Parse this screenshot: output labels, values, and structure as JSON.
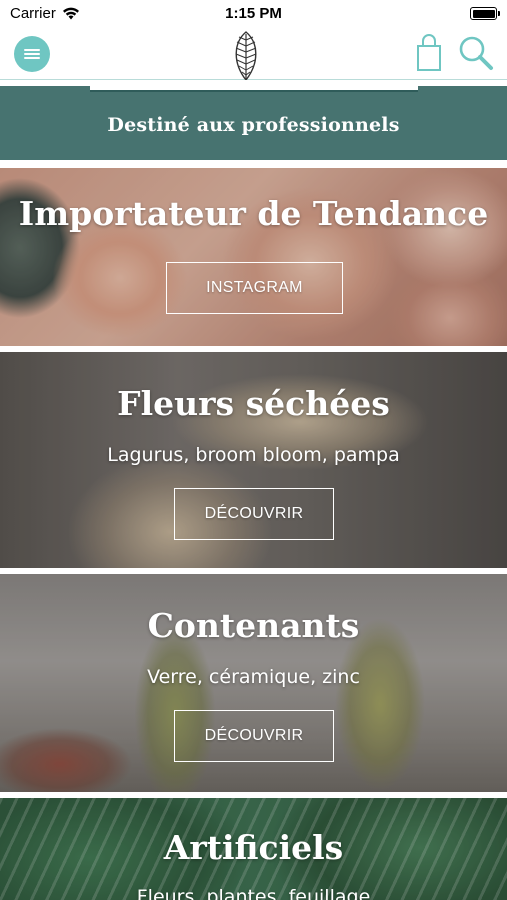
{
  "status_bar": {
    "carrier": "Carrier",
    "time": "1:15 PM"
  },
  "nav": {
    "menu_icon": "hamburger-menu-icon",
    "logo_icon": "leaf-logo-icon",
    "bag_icon": "shopping-bag-icon",
    "search_icon": "search-icon"
  },
  "banner": {
    "text": "Destiné aux professionnels"
  },
  "cards": [
    {
      "title": "Importateur de Tendance",
      "subtitle": "",
      "button": "INSTAGRAM"
    },
    {
      "title": "Fleurs séchées",
      "subtitle": "Lagurus, broom bloom, pampa",
      "button": "DÉCOUVRIR"
    },
    {
      "title": "Contenants",
      "subtitle": "Verre, céramique, zinc",
      "button": "DÉCOUVRIR"
    },
    {
      "title": "Artificiels",
      "subtitle": "Fleurs, plantes, feuillage"
    }
  ],
  "colors": {
    "banner": "#477370",
    "accent": "#6fc6c2"
  }
}
